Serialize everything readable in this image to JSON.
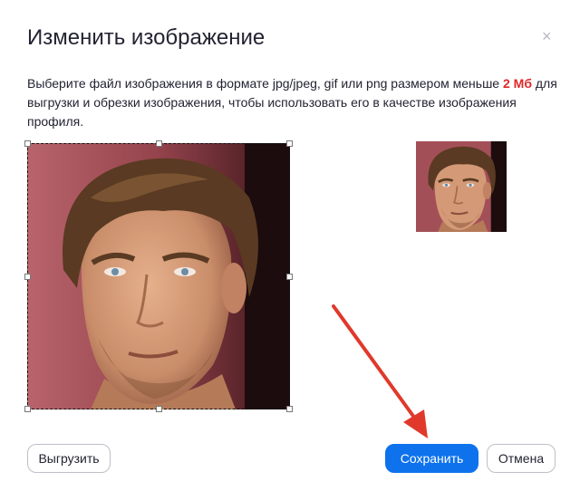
{
  "dialog": {
    "title": "Изменить изображение",
    "close_icon": "×",
    "description_before": "Выберите файл изображения в формате jpg/jpeg, gif или png размером меньше ",
    "description_highlight": "2 Мб",
    "description_after": " для выгрузки и обрезки изображения, чтобы использовать его в качестве изображения профиля.",
    "highlight_color": "#e02828"
  },
  "buttons": {
    "upload_label": "Выгрузить",
    "save_label": "Сохранить",
    "cancel_label": "Отмена",
    "primary_color": "#0e72ed"
  },
  "annotation": {
    "arrow_color": "#e0392b"
  }
}
